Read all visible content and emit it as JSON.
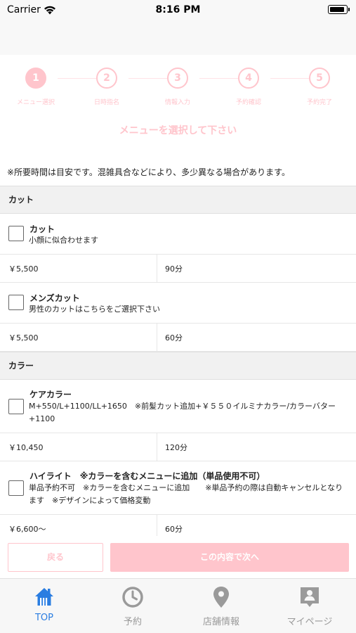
{
  "status_bar": {
    "carrier": "Carrier",
    "time": "8:16 PM"
  },
  "steps": [
    {
      "number": "1",
      "label": "メニュー選択"
    },
    {
      "number": "2",
      "label": "日時指名"
    },
    {
      "number": "3",
      "label": "情報入力"
    },
    {
      "number": "4",
      "label": "予約確認"
    },
    {
      "number": "5",
      "label": "予約完了"
    }
  ],
  "heading": "メニューを選択して下さい",
  "notice": "※所要時間は目安です。混雑具合などにより、多少異なる場合があります。",
  "categories": [
    {
      "name": "カット",
      "items": [
        {
          "name": "カット",
          "description": "小顔に似合わせます",
          "price": "￥5,500",
          "duration": "90分"
        },
        {
          "name": "メンズカット",
          "description": "男性のカットはこちらをご選択下さい",
          "price": "￥5,500",
          "duration": "60分"
        }
      ]
    },
    {
      "name": "カラー",
      "items": [
        {
          "name": "ケアカラー",
          "description": "M+550/L+1100/LL+1650　※前髪カット追加+￥５５０イルミナカラー/カラーバター+1100",
          "price": "￥10,450",
          "duration": "120分"
        },
        {
          "name": "ハイライト　※カラーを含むメニューに追加（単品使用不可）",
          "description": "単品予約不可　※カラーを含むメニューに追加　　※単品予約の際は自動キャンセルとなります　※デザインによって価格変動",
          "price": "￥6,600〜",
          "duration": "60分"
        }
      ]
    }
  ],
  "buttons": {
    "back": "戻る",
    "next": "この内容で次へ"
  },
  "tabs": [
    {
      "label": "TOP",
      "icon": "home-icon"
    },
    {
      "label": "予約",
      "icon": "clock-icon"
    },
    {
      "label": "店舗情報",
      "icon": "map-pin-icon"
    },
    {
      "label": "マイページ",
      "icon": "contact-card-icon"
    }
  ],
  "colors": {
    "accent_pink": "#ffc5cc",
    "tab_active": "#2a7de1",
    "tab_inactive": "#9a9a9a"
  }
}
